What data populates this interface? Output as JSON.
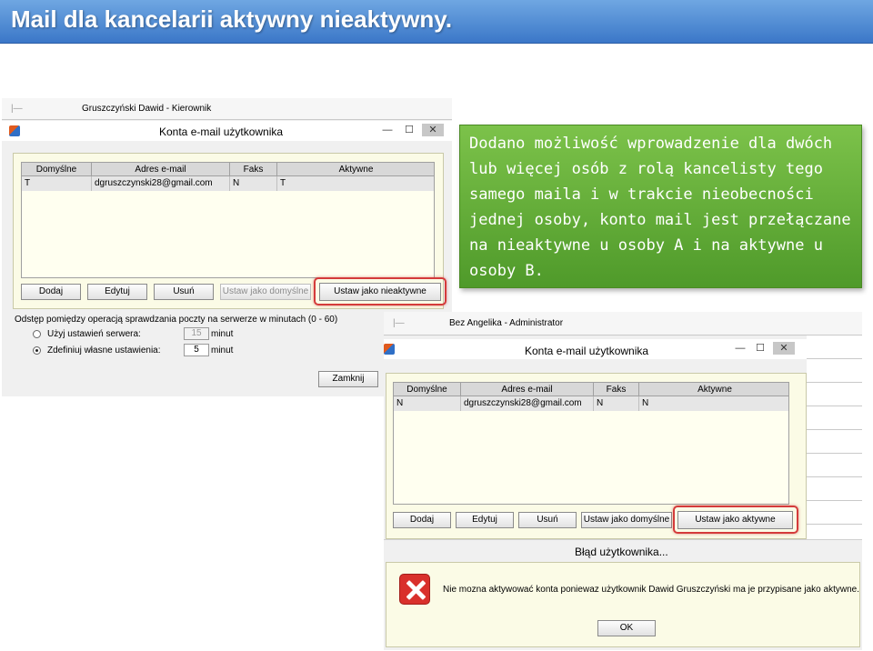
{
  "slide": {
    "title": "Mail dla kancelarii aktywny nieaktywny.",
    "callout": "Dodano możliwość wprowadzenie dla dwóch lub więcej osób z rolą kancelisty tego samego maila i w trakcie nieobecności jednej osoby, konto mail jest przełączane na nieaktywne u osoby A i na aktywne u osoby B."
  },
  "window1": {
    "bg_user": "Gruszczyński Dawid - Kierownik",
    "title": "Konta e-mail użytkownika",
    "min": "—",
    "max": "☐",
    "close": "✕",
    "columns": [
      "Domyślne",
      "Adres e-mail",
      "Faks",
      "Aktywne"
    ],
    "row": [
      "T",
      "dgruszczynski28@gmail.com",
      "N",
      "T"
    ],
    "buttons": {
      "add": "Dodaj",
      "edit": "Edytuj",
      "delete": "Usuń",
      "set_default": "Ustaw jako domyślne",
      "set_inactive": "Ustaw jako nieaktywne"
    },
    "interval_label": "Odstęp pomiędzy operacją sprawdzania poczty na serwerze w minutach (0 - 60)",
    "radio_server": "Użyj ustawień serwera:",
    "radio_own": "Zdefiniuj własne ustawienia:",
    "server_value": "15",
    "own_value": "5",
    "unit": "minut",
    "close_btn": "Zamknij"
  },
  "window2": {
    "bg_user": "Bez Angelika - Administrator",
    "title": "Konta e-mail użytkownika",
    "min": "—",
    "max": "☐",
    "close": "✕",
    "columns": [
      "Domyślne",
      "Adres e-mail",
      "Faks",
      "Aktywne"
    ],
    "row": [
      "N",
      "dgruszczynski28@gmail.com",
      "N",
      "N"
    ],
    "buttons": {
      "add": "Dodaj",
      "edit": "Edytuj",
      "delete": "Usuń",
      "set_default": "Ustaw jako domyślne",
      "set_active": "Ustaw jako aktywne"
    }
  },
  "error_dialog": {
    "title": "Błąd użytkownika...",
    "message": "Nie mozna aktywować konta poniewaz użytkownik Dawid Gruszczyński ma je przypisane jako aktywne.",
    "ok": "OK"
  }
}
